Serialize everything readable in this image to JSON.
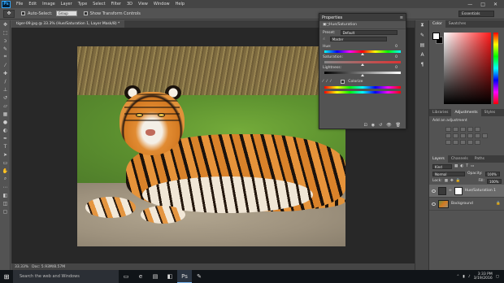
{
  "app": {
    "logo": "Ps"
  },
  "menubar": {
    "items": [
      "File",
      "Edit",
      "Image",
      "Layer",
      "Type",
      "Select",
      "Filter",
      "3D",
      "View",
      "Window",
      "Help"
    ],
    "win_controls": [
      "—",
      "□",
      "✕"
    ]
  },
  "options": {
    "auto_select_label": "Auto-Select:",
    "auto_select_value": "Group",
    "transform_label": "Show Transform Controls",
    "workspace": "Essentials"
  },
  "document": {
    "tab_title": "tiger-09.jpg @ 33.3% (Hue/Saturation 1, Layer Mask/8) *",
    "zoom": "33.33%",
    "doc_info": "Doc: 5.93M/8.57M"
  },
  "properties": {
    "title": "Properties",
    "subtitle": "Hue/Saturation",
    "preset_label": "Preset:",
    "preset_value": "Default",
    "channel_value": "Master",
    "hue_label": "Hue:",
    "hue_value": "0",
    "saturation_label": "Saturation:",
    "saturation_value": "0",
    "lightness_label": "Lightness:",
    "lightness_value": "0",
    "colorize_label": "Colorize"
  },
  "color_panel": {
    "tabs": [
      "Color",
      "Swatches"
    ],
    "fg": "#ffffff",
    "bg": "#000000"
  },
  "adjustments": {
    "tabs": [
      "Libraries",
      "Adjustments",
      "Styles"
    ],
    "add_label": "Add an adjustment"
  },
  "layers": {
    "tabs": [
      "Layers",
      "Channels",
      "Paths"
    ],
    "kind_label": "Kind",
    "blend_mode": "Normal",
    "opacity_label": "Opacity:",
    "opacity_value": "100%",
    "lock_label": "Lock:",
    "fill_label": "Fill:",
    "fill_value": "100%",
    "items": [
      {
        "name": "Hue/Saturation 1",
        "type": "adjustment",
        "active": true
      },
      {
        "name": "Background",
        "type": "image",
        "active": false
      }
    ]
  },
  "taskbar": {
    "search_placeholder": "Search the web and Windows",
    "time": "3:33 PM",
    "date": "3/19/2016"
  }
}
